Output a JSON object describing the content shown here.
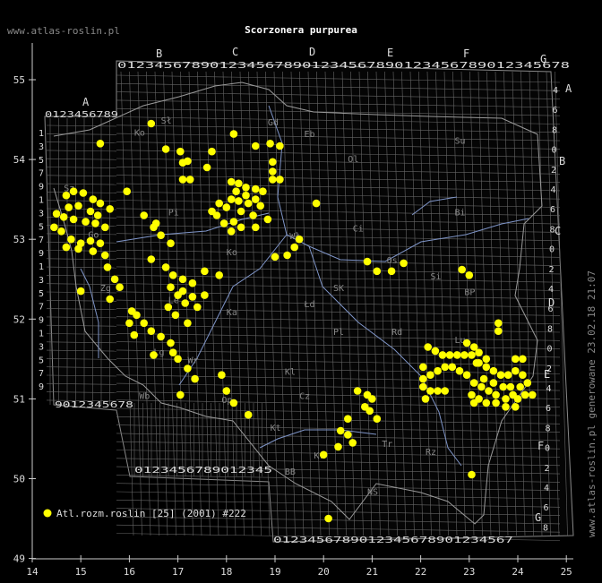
{
  "title": "Scorzonera purpurea",
  "site_watermark": "www.atlas-roslin.pl",
  "side_watermark": "www.atlas-roslin.pl generowane 23.02.18 21:07",
  "legend": {
    "label": "Atl.rozm.roslin [25] (2001) #222",
    "color": "#ffff00"
  },
  "axes": {
    "x_ticks": [
      "14",
      "15",
      "16",
      "17",
      "18",
      "19",
      "20",
      "21",
      "22",
      "23",
      "24",
      "25"
    ],
    "y_ticks": [
      "55",
      "54",
      "53",
      "52",
      "51",
      "50",
      "49"
    ]
  },
  "grid_letters": {
    "top": [
      "A",
      "B",
      "C",
      "D",
      "E",
      "F",
      "G"
    ],
    "right": [
      "A",
      "B",
      "C",
      "D",
      "E",
      "F",
      "G"
    ]
  },
  "square_digits": {
    "top_main": "0123456789012345678901234567890123456789012345678",
    "top_a": "0123456789",
    "bottom_main": "0123456789012345678901234567",
    "bottom_mid": "0123456789012345678901234567890123456789012345",
    "bottom_left": "9012345678",
    "left_col": [
      "1",
      "3",
      "5",
      "7",
      "9",
      "1",
      "3",
      "5",
      "7",
      "9",
      "1",
      "3",
      "5",
      "7",
      "9",
      "1",
      "3",
      "5",
      "7",
      "9"
    ],
    "right_col": [
      "4",
      "6",
      "8",
      "0",
      "2",
      "4",
      "6",
      "8",
      "0",
      "2",
      "4",
      "6",
      "8",
      "0",
      "2",
      "4",
      "6",
      "8",
      "0",
      "2",
      "4",
      "6",
      "8"
    ]
  },
  "region_labels": [
    {
      "t": "Sł",
      "x": 16.65,
      "y": 54.45
    },
    {
      "t": "Gd",
      "x": 18.85,
      "y": 54.43
    },
    {
      "t": "Eb",
      "x": 19.6,
      "y": 54.28
    },
    {
      "t": "Su",
      "x": 22.7,
      "y": 54.2
    },
    {
      "t": "Ko",
      "x": 16.1,
      "y": 54.3
    },
    {
      "t": "Ol",
      "x": 20.5,
      "y": 53.97
    },
    {
      "t": "Sz",
      "x": 14.65,
      "y": 53.6
    },
    {
      "t": "Pi",
      "x": 16.8,
      "y": 53.3
    },
    {
      "t": "Bi",
      "x": 22.7,
      "y": 53.3
    },
    {
      "t": "Ci",
      "x": 20.6,
      "y": 53.1
    },
    {
      "t": "Go",
      "x": 15.15,
      "y": 53.02
    },
    {
      "t": "Wł",
      "x": 19.3,
      "y": 53.0
    },
    {
      "t": "Ko",
      "x": 18.0,
      "y": 52.8
    },
    {
      "t": "Os",
      "x": 21.3,
      "y": 52.7
    },
    {
      "t": "Si",
      "x": 22.2,
      "y": 52.5
    },
    {
      "t": "Zg",
      "x": 15.4,
      "y": 52.35
    },
    {
      "t": "SK",
      "x": 20.2,
      "y": 52.35
    },
    {
      "t": "BP",
      "x": 22.9,
      "y": 52.3
    },
    {
      "t": "Łd",
      "x": 19.6,
      "y": 52.15
    },
    {
      "t": "Le",
      "x": 16.8,
      "y": 52.2
    },
    {
      "t": "Ka",
      "x": 18.0,
      "y": 52.05
    },
    {
      "t": "Pl",
      "x": 20.2,
      "y": 51.8
    },
    {
      "t": "Rd",
      "x": 21.4,
      "y": 51.8
    },
    {
      "t": "Lu",
      "x": 22.7,
      "y": 51.7
    },
    {
      "t": "Lg",
      "x": 16.5,
      "y": 51.55
    },
    {
      "t": "Wr",
      "x": 17.2,
      "y": 51.45
    },
    {
      "t": "Kl",
      "x": 19.2,
      "y": 51.3
    },
    {
      "t": "Wb",
      "x": 16.2,
      "y": 51.0
    },
    {
      "t": "Cz",
      "x": 19.5,
      "y": 51.0
    },
    {
      "t": "Op",
      "x": 17.9,
      "y": 50.95
    },
    {
      "t": "Kt",
      "x": 18.9,
      "y": 50.6
    },
    {
      "t": "Tr",
      "x": 21.2,
      "y": 50.4
    },
    {
      "t": "Kr",
      "x": 19.8,
      "y": 50.25
    },
    {
      "t": "BB",
      "x": 19.2,
      "y": 50.05
    },
    {
      "t": "Rz",
      "x": 22.1,
      "y": 50.3
    },
    {
      "t": "NS",
      "x": 20.9,
      "y": 49.8
    }
  ],
  "records": [
    [
      15.4,
      54.2
    ],
    [
      16.45,
      54.45
    ],
    [
      18.15,
      54.32
    ],
    [
      16.75,
      54.13
    ],
    [
      17.05,
      54.1
    ],
    [
      17.7,
      54.1
    ],
    [
      18.9,
      54.2
    ],
    [
      18.6,
      54.17
    ],
    [
      19.1,
      54.17
    ],
    [
      17.1,
      53.96
    ],
    [
      17.2,
      53.98
    ],
    [
      17.6,
      53.9
    ],
    [
      18.95,
      53.97
    ],
    [
      18.95,
      53.85
    ],
    [
      18.95,
      53.75
    ],
    [
      19.1,
      53.75
    ],
    [
      17.1,
      53.75
    ],
    [
      17.25,
      53.75
    ],
    [
      18.1,
      53.72
    ],
    [
      18.25,
      53.7
    ],
    [
      18.4,
      53.65
    ],
    [
      18.6,
      53.63
    ],
    [
      18.75,
      53.6
    ],
    [
      18.2,
      53.6
    ],
    [
      18.4,
      53.55
    ],
    [
      18.6,
      53.5
    ],
    [
      18.1,
      53.5
    ],
    [
      18.25,
      53.48
    ],
    [
      18.45,
      53.45
    ],
    [
      18.7,
      53.42
    ],
    [
      17.85,
      53.45
    ],
    [
      18.0,
      53.4
    ],
    [
      18.3,
      53.35
    ],
    [
      18.55,
      53.3
    ],
    [
      18.85,
      53.25
    ],
    [
      17.8,
      53.3
    ],
    [
      17.95,
      53.2
    ],
    [
      18.15,
      53.22
    ],
    [
      18.3,
      53.15
    ],
    [
      18.6,
      53.15
    ],
    [
      17.7,
      53.35
    ],
    [
      18.1,
      53.1
    ],
    [
      19.5,
      53.0
    ],
    [
      19.4,
      52.9
    ],
    [
      19.25,
      52.8
    ],
    [
      19.0,
      52.78
    ],
    [
      19.85,
      53.45
    ],
    [
      14.7,
      53.55
    ],
    [
      14.85,
      53.6
    ],
    [
      15.05,
      53.58
    ],
    [
      15.25,
      53.5
    ],
    [
      15.4,
      53.45
    ],
    [
      15.6,
      53.38
    ],
    [
      14.75,
      53.4
    ],
    [
      14.95,
      53.42
    ],
    [
      15.2,
      53.35
    ],
    [
      15.35,
      53.3
    ],
    [
      14.5,
      53.32
    ],
    [
      14.65,
      53.28
    ],
    [
      14.85,
      53.25
    ],
    [
      15.1,
      53.22
    ],
    [
      15.3,
      53.2
    ],
    [
      15.5,
      53.15
    ],
    [
      14.45,
      53.15
    ],
    [
      14.6,
      53.1
    ],
    [
      14.8,
      53.0
    ],
    [
      15.0,
      52.95
    ],
    [
      15.2,
      52.98
    ],
    [
      15.4,
      52.95
    ],
    [
      14.7,
      52.9
    ],
    [
      14.95,
      52.88
    ],
    [
      15.25,
      52.85
    ],
    [
      15.5,
      52.8
    ],
    [
      15.55,
      52.65
    ],
    [
      15.7,
      52.5
    ],
    [
      15.0,
      52.35
    ],
    [
      15.6,
      52.25
    ],
    [
      15.8,
      52.4
    ],
    [
      15.95,
      53.6
    ],
    [
      16.3,
      53.3
    ],
    [
      16.5,
      53.15
    ],
    [
      16.65,
      53.05
    ],
    [
      16.85,
      52.95
    ],
    [
      16.55,
      53.2
    ],
    [
      16.45,
      52.75
    ],
    [
      16.75,
      52.65
    ],
    [
      16.9,
      52.55
    ],
    [
      17.1,
      52.5
    ],
    [
      17.3,
      52.45
    ],
    [
      17.1,
      52.35
    ],
    [
      17.3,
      52.28
    ],
    [
      16.85,
      52.4
    ],
    [
      17.0,
      52.3
    ],
    [
      17.15,
      52.2
    ],
    [
      16.8,
      52.15
    ],
    [
      16.95,
      52.05
    ],
    [
      17.2,
      51.95
    ],
    [
      17.55,
      52.6
    ],
    [
      17.85,
      52.55
    ],
    [
      17.55,
      52.3
    ],
    [
      17.4,
      52.15
    ],
    [
      16.05,
      52.1
    ],
    [
      16.15,
      52.05
    ],
    [
      16.3,
      51.95
    ],
    [
      16.45,
      51.85
    ],
    [
      16.65,
      51.78
    ],
    [
      16.85,
      51.7
    ],
    [
      16.9,
      51.58
    ],
    [
      17.0,
      51.5
    ],
    [
      17.2,
      51.38
    ],
    [
      17.35,
      51.25
    ],
    [
      17.05,
      51.05
    ],
    [
      18.0,
      51.1
    ],
    [
      17.9,
      51.3
    ],
    [
      18.15,
      50.95
    ],
    [
      18.45,
      50.8
    ],
    [
      16.1,
      51.8
    ],
    [
      16.5,
      51.55
    ],
    [
      16.0,
      51.95
    ],
    [
      20.7,
      51.1
    ],
    [
      20.9,
      51.05
    ],
    [
      21.0,
      51.0
    ],
    [
      20.95,
      50.85
    ],
    [
      21.1,
      50.75
    ],
    [
      20.85,
      50.9
    ],
    [
      20.5,
      50.75
    ],
    [
      20.35,
      50.6
    ],
    [
      20.5,
      50.55
    ],
    [
      20.6,
      50.45
    ],
    [
      20.3,
      50.4
    ],
    [
      20.0,
      50.3
    ],
    [
      20.1,
      49.5
    ],
    [
      23.05,
      50.05
    ],
    [
      20.9,
      52.72
    ],
    [
      21.1,
      52.6
    ],
    [
      21.4,
      52.6
    ],
    [
      21.65,
      52.7
    ],
    [
      22.85,
      52.62
    ],
    [
      23.0,
      52.55
    ],
    [
      23.6,
      51.95
    ],
    [
      23.6,
      51.85
    ],
    [
      22.15,
      51.65
    ],
    [
      22.3,
      51.6
    ],
    [
      22.45,
      51.55
    ],
    [
      22.6,
      51.55
    ],
    [
      22.75,
      51.55
    ],
    [
      22.9,
      51.55
    ],
    [
      23.05,
      51.55
    ],
    [
      23.2,
      51.58
    ],
    [
      22.95,
      51.7
    ],
    [
      23.1,
      51.65
    ],
    [
      23.2,
      51.45
    ],
    [
      23.35,
      51.4
    ],
    [
      23.5,
      51.35
    ],
    [
      23.65,
      51.3
    ],
    [
      23.8,
      51.3
    ],
    [
      23.95,
      51.35
    ],
    [
      24.1,
      51.3
    ],
    [
      24.2,
      51.2
    ],
    [
      24.05,
      51.15
    ],
    [
      23.9,
      51.05
    ],
    [
      23.75,
      51.0
    ],
    [
      23.55,
      51.05
    ],
    [
      23.4,
      51.1
    ],
    [
      23.25,
      51.15
    ],
    [
      23.1,
      51.2
    ],
    [
      22.95,
      51.3
    ],
    [
      22.8,
      51.35
    ],
    [
      22.65,
      51.4
    ],
    [
      22.5,
      51.4
    ],
    [
      22.35,
      51.35
    ],
    [
      22.2,
      51.3
    ],
    [
      22.05,
      51.25
    ],
    [
      22.05,
      51.15
    ],
    [
      22.2,
      51.1
    ],
    [
      22.35,
      51.1
    ],
    [
      22.5,
      51.1
    ],
    [
      22.1,
      51.0
    ],
    [
      23.05,
      51.05
    ],
    [
      23.2,
      51.0
    ],
    [
      23.35,
      50.95
    ],
    [
      23.55,
      50.95
    ],
    [
      23.75,
      50.9
    ],
    [
      23.95,
      50.9
    ],
    [
      24.15,
      51.05
    ],
    [
      24.3,
      51.05
    ],
    [
      23.1,
      50.95
    ],
    [
      23.3,
      51.25
    ],
    [
      23.5,
      51.2
    ],
    [
      23.7,
      51.15
    ],
    [
      23.85,
      51.15
    ],
    [
      24.0,
      51.0
    ],
    [
      23.15,
      51.45
    ],
    [
      23.35,
      51.5
    ],
    [
      22.05,
      51.4
    ],
    [
      23.95,
      51.5
    ],
    [
      24.1,
      51.5
    ]
  ]
}
